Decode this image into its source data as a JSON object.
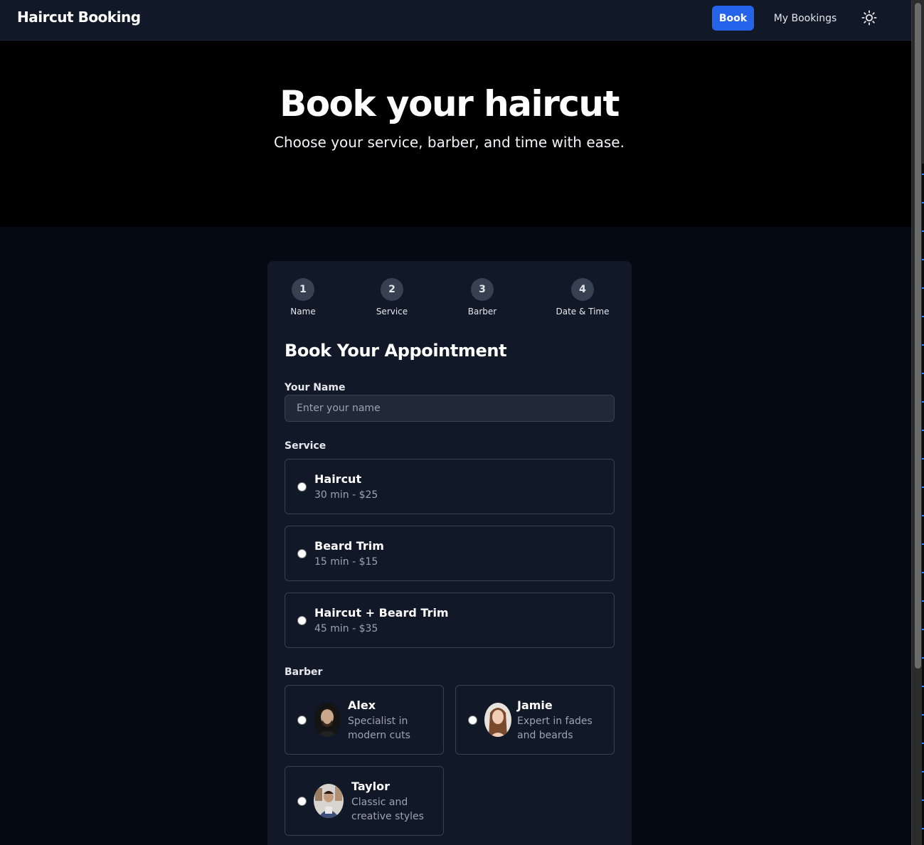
{
  "nav": {
    "brand": "Haircut Booking",
    "book": "Book",
    "my_bookings": "My Bookings",
    "theme_icon": "sun-icon"
  },
  "hero": {
    "title": "Book your haircut",
    "subtitle": "Choose your service, barber, and time with ease."
  },
  "steps": [
    {
      "number": "1",
      "label": "Name"
    },
    {
      "number": "2",
      "label": "Service"
    },
    {
      "number": "3",
      "label": "Barber"
    },
    {
      "number": "4",
      "label": "Date & Time"
    }
  ],
  "form": {
    "title": "Book Your Appointment",
    "name_label": "Your Name",
    "name_value": "",
    "name_placeholder": "Enter your name",
    "service_label": "Service",
    "services": [
      {
        "name": "Haircut",
        "details": "30 min - $25"
      },
      {
        "name": "Beard Trim",
        "details": "15 min - $15"
      },
      {
        "name": "Haircut + Beard Trim",
        "details": "45 min - $35"
      }
    ],
    "barber_label": "Barber",
    "barbers": [
      {
        "name": "Alex",
        "specialty": "Specialist in modern cuts"
      },
      {
        "name": "Jamie",
        "specialty": "Expert in fades and beards"
      },
      {
        "name": "Taylor",
        "specialty": "Classic and creative styles"
      }
    ]
  },
  "colors": {
    "accent": "#2563eb",
    "card": "#111827",
    "page": "#050914",
    "hero": "#000000"
  }
}
